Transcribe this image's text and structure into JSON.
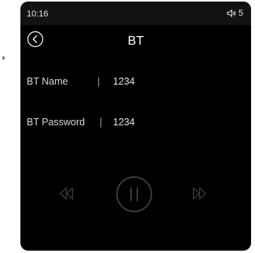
{
  "status": {
    "time": "10:16",
    "volume_level": "5",
    "volume_icon": "speaker-icon"
  },
  "header": {
    "title": "BT",
    "back_icon": "back-arrow-icon"
  },
  "fields": {
    "name": {
      "label": "BT Name",
      "separator": "|",
      "value": "1234"
    },
    "password": {
      "label": "BT Password",
      "separator": "|",
      "value": "1234"
    }
  },
  "controls": {
    "prev_icon": "rewind-icon",
    "play_pause_icon": "pause-icon",
    "next_icon": "fast-forward-icon",
    "color": "#3b3b3b"
  },
  "colors": {
    "background": "#000000",
    "statusbar": "#121212",
    "text": "#ffffff"
  }
}
